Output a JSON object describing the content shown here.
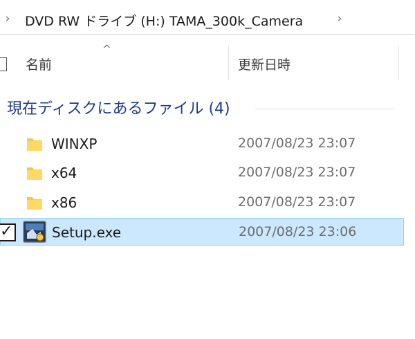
{
  "address": {
    "path": "DVD RW ドライブ (H:) TAMA_300k_Camera",
    "left_chevron_icon": "chevron-right-icon",
    "right_chevron_icon": "chevron-right-icon"
  },
  "columns": {
    "name": "名前",
    "date": "更新日時",
    "sort_icon": "sort-up-icon"
  },
  "group": {
    "title": "現在ディスクにあるファイル (4)"
  },
  "items": [
    {
      "name": "WINXP",
      "date": "2007/08/23 23:07",
      "type": "folder",
      "selected": false
    },
    {
      "name": "x64",
      "date": "2007/08/23 23:07",
      "type": "folder",
      "selected": false
    },
    {
      "name": "x86",
      "date": "2007/08/23 23:07",
      "type": "folder",
      "selected": false
    },
    {
      "name": "Setup.exe",
      "date": "2007/08/23 23:06",
      "type": "exe",
      "selected": true
    }
  ],
  "colors": {
    "group_title": "#1e3a8a",
    "selection_bg": "#cce8ff",
    "selection_border": "#99d1ff",
    "folder": "#f5c84b"
  }
}
